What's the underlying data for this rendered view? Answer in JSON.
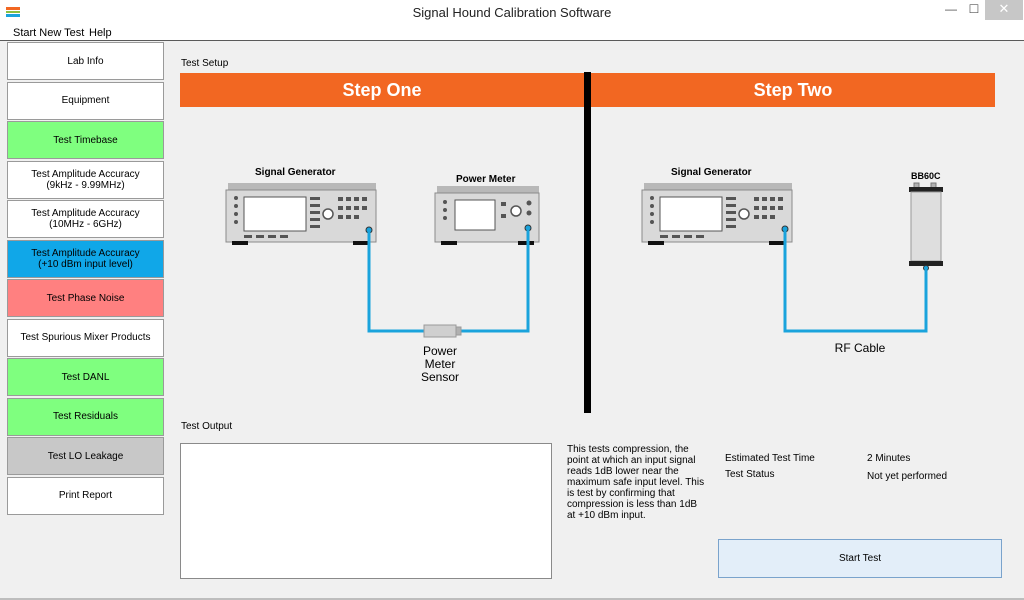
{
  "window": {
    "title": "Signal Hound Calibration Software",
    "minimize": "—",
    "maximize": "☐",
    "close": "✕"
  },
  "menu": [
    "Start New Test",
    "Help"
  ],
  "sidebar": {
    "items": [
      {
        "lines": [
          "Lab Info"
        ],
        "color": "#ffffff"
      },
      {
        "lines": [
          "Equipment"
        ],
        "color": "#ffffff"
      },
      {
        "lines": [
          "Test Timebase"
        ],
        "color": "#7fff7f"
      },
      {
        "lines": [
          "Test Amplitude Accuracy",
          "(9kHz - 9.99MHz)"
        ],
        "color": "#ffffff"
      },
      {
        "lines": [
          "Test Amplitude Accuracy",
          "(10MHz - 6GHz)"
        ],
        "color": "#ffffff"
      },
      {
        "lines": [
          "Test Amplitude Accuracy",
          "(+10 dBm input level)"
        ],
        "color": "#10a7e8"
      },
      {
        "lines": [
          "Test Phase Noise"
        ],
        "color": "#ff8080"
      },
      {
        "lines": [
          "Test Spurious Mixer Products"
        ],
        "color": "#ffffff"
      },
      {
        "lines": [
          "Test DANL"
        ],
        "color": "#7fff7f"
      },
      {
        "lines": [
          "Test Residuals"
        ],
        "color": "#7fff7f"
      },
      {
        "lines": [
          "Test LO Leakage"
        ],
        "color": "#c8c8c8"
      },
      {
        "lines": [
          "Print Report"
        ],
        "color": "#ffffff"
      }
    ]
  },
  "setup": {
    "label": "Test Setup",
    "step_one": "Step One",
    "step_two": "Step Two",
    "sig_gen_1": "Signal Generator",
    "power_meter": "Power Meter",
    "sensor_caption": [
      "Power",
      "Meter",
      "Sensor"
    ],
    "sig_gen_2": "Signal Generator",
    "device": "BB60C",
    "cable_caption": "RF Cable"
  },
  "output": {
    "label": "Test Output",
    "value": "",
    "description": "This tests compression, the point at which an input signal reads 1dB lower near the maximum safe input level. This is test by confirming that compression is less than 1dB at +10 dBm input.",
    "est_time_label": "Estimated Test Time",
    "est_time_value": "2 Minutes",
    "status_label": "Test Status",
    "status_value": "Not yet performed",
    "start_button": "Start Test"
  },
  "colors": {
    "accent": "#f26722",
    "cable": "#1aa3dc"
  }
}
